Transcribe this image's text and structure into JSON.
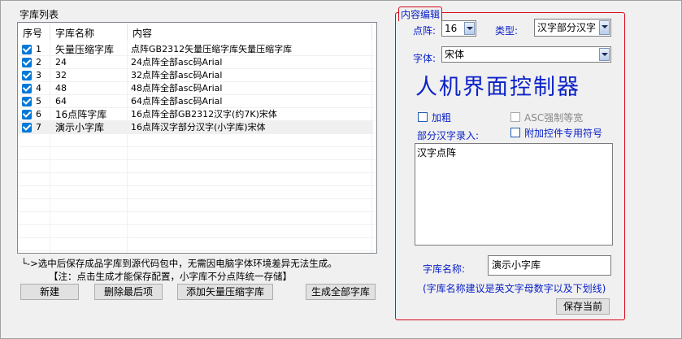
{
  "library_list": {
    "title": "字库列表",
    "columns": [
      "序号",
      "字库名称",
      "内容"
    ],
    "rows": [
      {
        "index": "1",
        "name": "矢量压缩字库",
        "content": "点阵GB2312矢量压缩字库矢量压缩字库",
        "checked": true
      },
      {
        "index": "2",
        "name": "24",
        "content": "24点阵全部asc码Arial",
        "checked": true
      },
      {
        "index": "3",
        "name": "32",
        "content": "32点阵全部asc码Arial",
        "checked": true
      },
      {
        "index": "4",
        "name": "48",
        "content": "48点阵全部asc码Arial",
        "checked": true
      },
      {
        "index": "5",
        "name": "64",
        "content": "64点阵全部asc码Arial",
        "checked": true
      },
      {
        "index": "6",
        "name": "16点阵字库",
        "content": "16点阵全部GB2312汉字(约7K)宋体",
        "checked": true
      },
      {
        "index": "7",
        "name": "演示小字库",
        "content": "16点阵汉字部分汉字(小字库)宋体",
        "checked": true
      }
    ],
    "note1": "└->选中后保存成品字库到源代码包中，无需因电脑字体环境差异无法生成。",
    "note2": "【注：点击生成才能保存配置，小字库不分点阵统一存储】",
    "buttons": {
      "new": "新建",
      "delete_last": "删除最后项",
      "add_vector": "添加矢量压缩字库",
      "generate_all": "生成全部字库"
    }
  },
  "editor": {
    "title": "内容编辑",
    "dot_label": "点阵:",
    "dot_value": "16",
    "type_label": "类型:",
    "type_value": "汉字部分汉字",
    "font_label": "字体:",
    "font_value": "宋体",
    "preview_text": "人机界面控制器",
    "bold_label": "加粗",
    "asc_label": "ASC强制等宽",
    "partial_label": "部分汉字录入:",
    "extra_symbols_label": "附加控件专用符号",
    "partial_text": "汉字点阵",
    "name_label": "字库名称:",
    "name_value": "演示小字库",
    "name_hint": "(字库名称建议是英文字母数字以及下划线)",
    "save_button": "保存当前"
  }
}
